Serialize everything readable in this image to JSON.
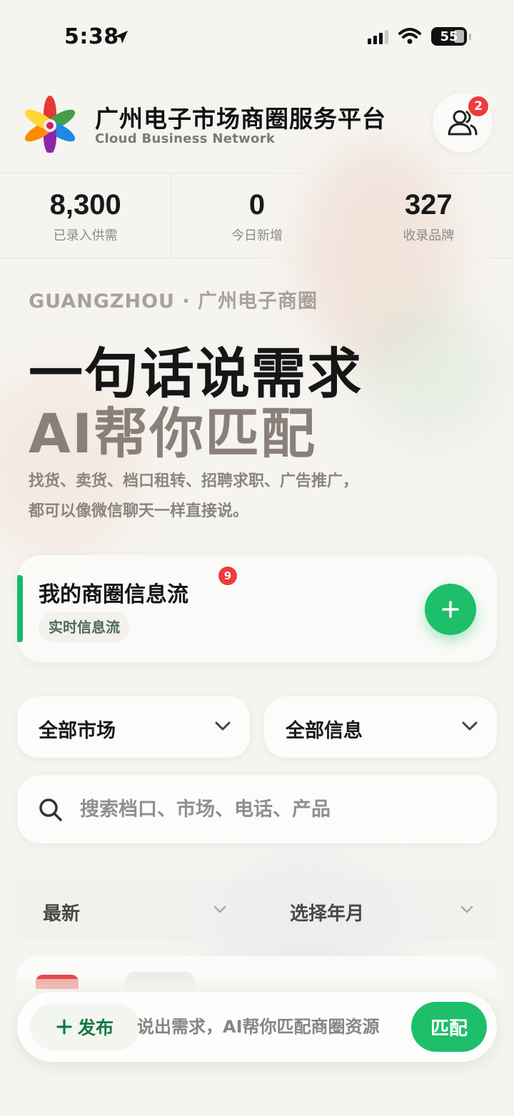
{
  "status_bar": {
    "time": "5:38",
    "battery": "55"
  },
  "header": {
    "title": "广州电子市场商圈服务平台",
    "subtitle": "Cloud Business Network",
    "user_badge": "2"
  },
  "stats": [
    {
      "value": "8,300",
      "label": "已录入供需"
    },
    {
      "value": "0",
      "label": "今日新增"
    },
    {
      "value": "327",
      "label": "收录品牌"
    }
  ],
  "hero": {
    "kicker": "GUANGZHOU · 广州电子商圈",
    "line1": "一句话说需求",
    "line2": "AI帮你匹配",
    "desc_line1": "找货、卖货、档口租转、招聘求职、广告推广，",
    "desc_line2": "都可以像微信聊天一样直接说。"
  },
  "feed_card": {
    "title": "我的商圈信息流",
    "badge": "9",
    "tag": "实时信息流",
    "add_label": "+"
  },
  "filters": {
    "market": "全部市场",
    "info": "全部信息",
    "sort": "最新",
    "date": "选择年月"
  },
  "search": {
    "placeholder": "搜索档口、市场、电话、产品",
    "value": ""
  },
  "bottom_bar": {
    "publish_label": "发布",
    "prompt_placeholder": "说出需求，AI帮你匹配商圈资源",
    "match_label": "匹配"
  },
  "colors": {
    "accent": "#1dbf6a",
    "badge": "#ee3b3b",
    "feed_bar": "#17b86a"
  },
  "icons": [
    "location-arrow-icon",
    "signal-icon",
    "wifi-icon",
    "battery-icon",
    "users-icon",
    "plus-icon",
    "chevron-down-icon",
    "search-icon"
  ]
}
